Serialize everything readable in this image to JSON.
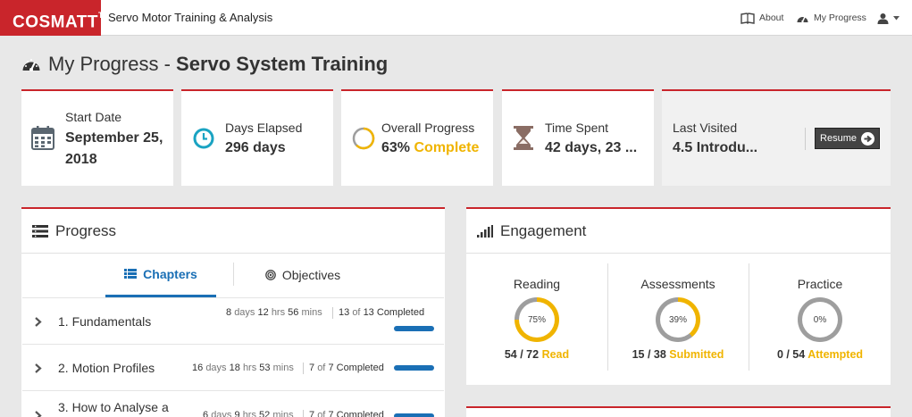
{
  "header": {
    "brand": "COSMATT",
    "brand_tm": "TM",
    "app_title": "Servo Motor Training & Analysis",
    "nav": {
      "about": "About",
      "my_progress": "My Progress"
    }
  },
  "page": {
    "title_prefix": "My Progress - ",
    "title_course": "Servo System Training"
  },
  "stats": {
    "start_date": {
      "label": "Start Date",
      "value_line1": "September 25,",
      "value_line2": "2018"
    },
    "days_elapsed": {
      "label": "Days Elapsed",
      "value": "296 days"
    },
    "overall_progress": {
      "label": "Overall Progress",
      "value": "63%",
      "value_suffix": "Complete"
    },
    "time_spent": {
      "label": "Time Spent",
      "value": "42 days,  23 ..."
    },
    "last_visited": {
      "label": "Last Visited",
      "value": "4.5 Introdu...",
      "resume_label": "Resume"
    }
  },
  "progress_panel": {
    "title": "Progress",
    "tabs": {
      "chapters": "Chapters",
      "objectives": "Objectives"
    },
    "chapters": [
      {
        "name": "1. Fundamentals",
        "days": "8",
        "days_u": "days",
        "hrs": "12",
        "hrs_u": "hrs",
        "mins": "56",
        "mins_u": "mins",
        "done": "13",
        "of": "of",
        "total": "13",
        "status": "Completed",
        "progress": 1.0
      },
      {
        "name": "2. Motion Profiles",
        "days": "16",
        "days_u": "days",
        "hrs": "18",
        "hrs_u": "hrs",
        "mins": "53",
        "mins_u": "mins",
        "done": "7",
        "of": "of",
        "total": "7",
        "status": "Completed",
        "progress": 1.0
      },
      {
        "name": "3. How to Analyse a",
        "days": "6",
        "days_u": "days",
        "hrs": "9",
        "hrs_u": "hrs",
        "mins": "52",
        "mins_u": "mins",
        "done": "7",
        "of": "of",
        "total": "7",
        "status": "Completed",
        "progress": 1.0
      }
    ]
  },
  "engagement_panel": {
    "title": "Engagement",
    "reading": {
      "title": "Reading",
      "percent": "75%",
      "progress": 0.75,
      "count": "54 / 72",
      "word": "Read"
    },
    "assessments": {
      "title": "Assessments",
      "percent": "39%",
      "progress": 0.39,
      "count": "15 / 38",
      "word": "Submitted"
    },
    "practice": {
      "title": "Practice",
      "percent": "0%",
      "progress": 0.0,
      "count": "0 / 54",
      "word": "Attempted"
    }
  },
  "colors": {
    "brand_red": "#c9252b",
    "accent_blue": "#1a6fb5",
    "highlight_yellow": "#f0b400",
    "ring_grey": "#9e9e9e"
  }
}
